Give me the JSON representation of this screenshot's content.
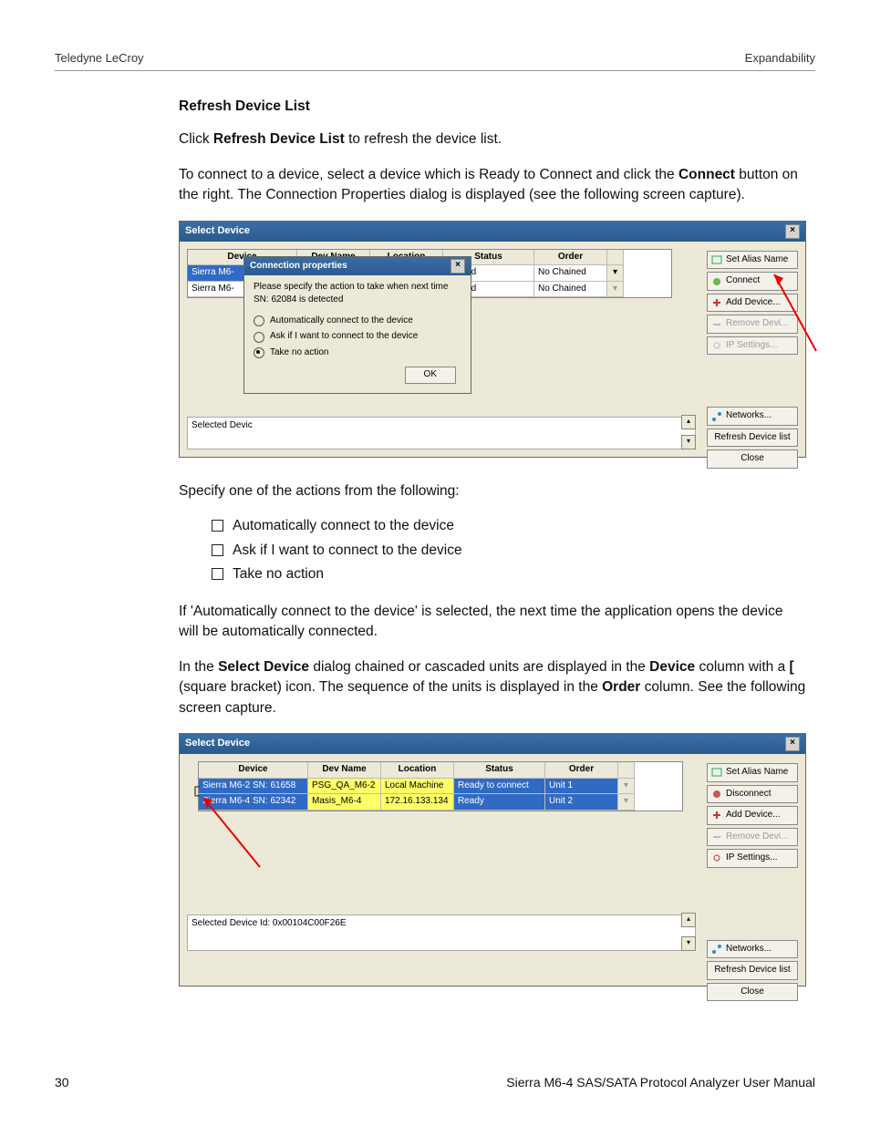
{
  "header": {
    "left": "Teledyne LeCroy",
    "right": "Expandability"
  },
  "section_title": "Refresh Device List",
  "p1_a": "Click ",
  "p1_b": "Refresh Device List",
  "p1_c": " to refresh the device list.",
  "p2_a": "To connect to a device, select a device which is Ready to Connect and click the ",
  "p2_b": "Connect",
  "p2_c": " button on the right. The Connection Properties dialog is displayed (see the following screen capture).",
  "p3": "Specify one of the actions from the following:",
  "bullets": [
    "Automatically connect to the device",
    "Ask if I want to connect to the device",
    "Take no action"
  ],
  "p4": "If 'Automatically connect to the device' is selected, the next time the application opens the device will be automatically connected.",
  "p5_a": "In the ",
  "p5_b": "Select Device",
  "p5_c": " dialog chained or cascaded units are displayed in the ",
  "p5_d": "Device",
  "p5_e": " column with a ",
  "p5_f": "[",
  "p5_g": " (square bracket) icon. The sequence of the units is displayed in the ",
  "p5_h": "Order",
  "p5_i": " column. See the following screen capture.",
  "footer": {
    "page": "30",
    "title": "Sierra M6-4 SAS/SATA Protocol Analyzer User Manual"
  },
  "dlg": {
    "title": "Select Device",
    "cols": [
      "Device",
      "Dev Name",
      "Location",
      "Status",
      "Order"
    ],
    "sel_label": "Selected Devic",
    "btns": {
      "alias": "Set Alias Name",
      "connect": "Connect",
      "disconnect": "Disconnect",
      "add": "Add Device...",
      "remove": "Remove Devi...",
      "ip": "IP Settings...",
      "net": "Networks...",
      "refresh": "Refresh Device list",
      "close": "Close"
    }
  },
  "shot1": {
    "rows": [
      {
        "device": "Sierra M6-",
        "status": "Locked",
        "order": "No Chained"
      },
      {
        "device": "Sierra M6-",
        "status": "Locked",
        "order": "No Chained"
      }
    ],
    "popup": {
      "title": "Connection properties",
      "msg": "Please specify the action to take when next time  SN: 62084 is detected",
      "opts": [
        "Automatically connect to the device",
        "Ask if I want to connect to the device",
        "Take no action"
      ],
      "checked": 2,
      "ok": "OK"
    }
  },
  "shot2": {
    "rows": [
      {
        "device": "Sierra M6-2 SN: 61658",
        "dev": "PSG_QA_M6-2",
        "loc": "Local Machine",
        "status": "Ready to connect",
        "order": "Unit 1"
      },
      {
        "device": "Sierra M6-4 SN: 62342",
        "dev": "Masis_M6-4",
        "loc": "172.16.133.134",
        "status": "Ready",
        "order": "Unit 2"
      }
    ],
    "sel_label": "Selected Device Id: 0x00104C00F26E"
  }
}
